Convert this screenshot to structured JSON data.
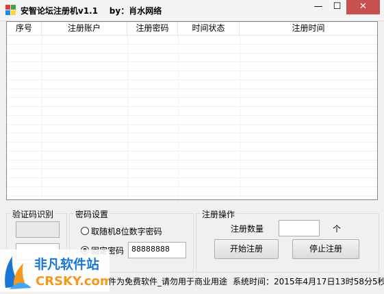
{
  "window": {
    "title": "安智论坛注册机v1.1    by：肖水网络",
    "minimize_glyph": "—",
    "maximize_glyph": "☐",
    "close_glyph": "✕"
  },
  "grid": {
    "columns": [
      "序号",
      "注册账户",
      "注册密码",
      "时间状态",
      "注册时间"
    ],
    "rows": []
  },
  "captcha": {
    "title": "验证码识别"
  },
  "password": {
    "title": "密码设置",
    "option_random": "取随机8位数字密码",
    "option_fixed": "固定密码",
    "fixed_value": "88888888",
    "selected": "fixed"
  },
  "register": {
    "title": "注册操作",
    "count_label": "注册数量",
    "count_value": "",
    "count_unit": "个",
    "start_label": "开始注册",
    "stop_label": "停止注册"
  },
  "status": {
    "notice": "件为免费软件_请勿用于商业用途",
    "time_label": "系统时间：2015年4月17日13时58分5秒"
  },
  "logo": {
    "name": "非凡软件站",
    "url": "CRSKY.com"
  },
  "colors": {
    "close_button": "#c75050",
    "logo_blue": "#1976d2",
    "logo_orange": "#f39a1d"
  }
}
